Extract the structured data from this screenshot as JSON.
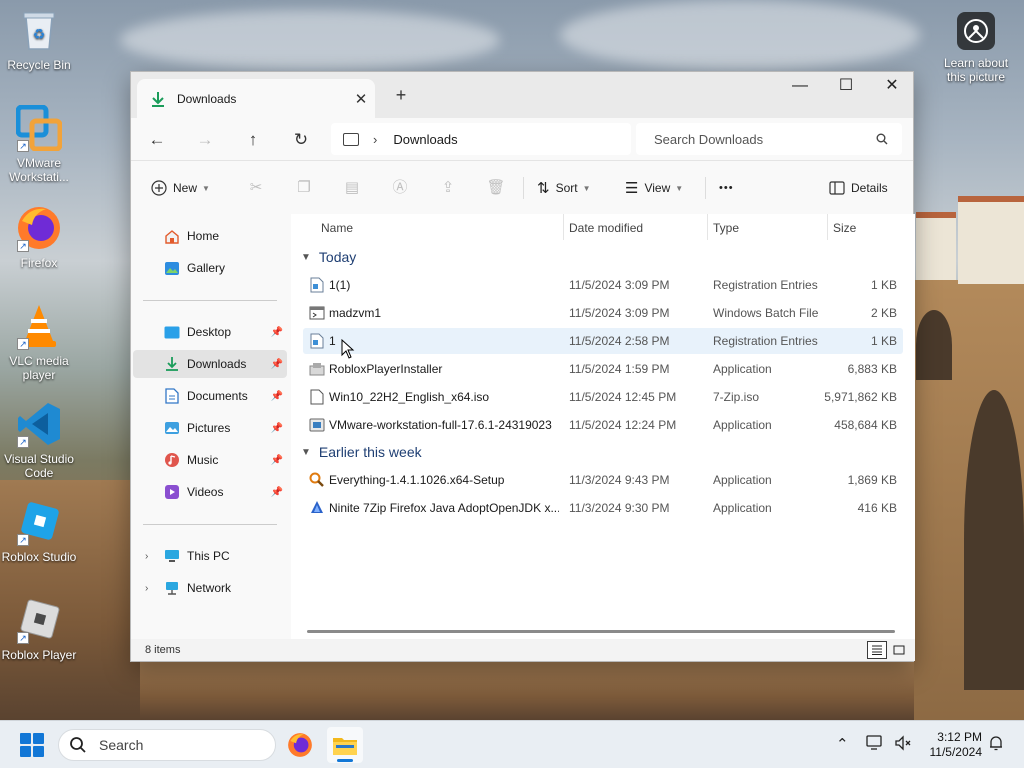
{
  "desktop": {
    "icons": [
      {
        "label": "Recycle Bin",
        "icon": "recycle-bin-icon"
      },
      {
        "label": "VMware Workstati...",
        "icon": "vmware-icon"
      },
      {
        "label": "Firefox",
        "icon": "firefox-icon"
      },
      {
        "label": "VLC media player",
        "icon": "vlc-icon"
      },
      {
        "label": "Visual Studio Code",
        "icon": "vscode-icon"
      },
      {
        "label": "Roblox Studio",
        "icon": "roblox-studio-icon"
      },
      {
        "label": "Roblox Player",
        "icon": "roblox-player-icon"
      }
    ],
    "learn_about": "Learn about this picture"
  },
  "window": {
    "tab_title": "Downloads",
    "new_tab": "+",
    "controls": {
      "minimize": "—",
      "maximize": "☐",
      "close": "✕"
    },
    "breadcrumb": "Downloads",
    "search_placeholder": "Search Downloads",
    "toolbar": {
      "new": "New",
      "sort": "Sort",
      "view": "View",
      "more": "•••",
      "details": "Details"
    }
  },
  "sidebar": {
    "items": [
      {
        "label": "Home",
        "icon": "home-icon"
      },
      {
        "label": "Gallery",
        "icon": "gallery-icon"
      },
      {
        "label": "Desktop",
        "icon": "desktop-folder-icon",
        "pinned": true
      },
      {
        "label": "Downloads",
        "icon": "downloads-icon",
        "pinned": true,
        "active": true
      },
      {
        "label": "Documents",
        "icon": "documents-icon",
        "pinned": true
      },
      {
        "label": "Pictures",
        "icon": "pictures-icon",
        "pinned": true
      },
      {
        "label": "Music",
        "icon": "music-icon",
        "pinned": true
      },
      {
        "label": "Videos",
        "icon": "videos-icon",
        "pinned": true
      },
      {
        "label": "This PC",
        "icon": "this-pc-icon"
      },
      {
        "label": "Network",
        "icon": "network-icon"
      }
    ]
  },
  "files": {
    "columns": [
      "Name",
      "Date modified",
      "Type",
      "Size"
    ],
    "groups": [
      {
        "label": "Today",
        "rows": [
          {
            "name": "1(1)",
            "date": "11/5/2024 3:09 PM",
            "type": "Registration Entries",
            "size": "1 KB",
            "icon": "registry-file-icon"
          },
          {
            "name": "madzvm1",
            "date": "11/5/2024 3:09 PM",
            "type": "Windows Batch File",
            "size": "2 KB",
            "icon": "batch-file-icon"
          },
          {
            "name": "1",
            "date": "11/5/2024 2:58 PM",
            "type": "Registration Entries",
            "size": "1 KB",
            "icon": "registry-file-icon",
            "selected": true
          },
          {
            "name": "RobloxPlayerInstaller",
            "date": "11/5/2024 1:59 PM",
            "type": "Application",
            "size": "6,883 KB",
            "icon": "roblox-installer-icon"
          },
          {
            "name": "Win10_22H2_English_x64.iso",
            "date": "11/5/2024 12:45 PM",
            "type": "7-Zip.iso",
            "size": "5,971,862 KB",
            "icon": "iso-file-icon"
          },
          {
            "name": "VMware-workstation-full-17.6.1-24319023",
            "date": "11/5/2024 12:24 PM",
            "type": "Application",
            "size": "458,684 KB",
            "icon": "vmware-installer-icon"
          }
        ]
      },
      {
        "label": "Earlier this week",
        "rows": [
          {
            "name": "Everything-1.4.1.1026.x64-Setup",
            "date": "11/3/2024 9:43 PM",
            "type": "Application",
            "size": "1,869 KB",
            "icon": "everything-icon"
          },
          {
            "name": "Ninite 7Zip Firefox Java AdoptOpenJDK x...",
            "date": "11/3/2024 9:30 PM",
            "type": "Application",
            "size": "416 KB",
            "icon": "ninite-icon"
          }
        ]
      }
    ]
  },
  "status": {
    "count": "8 items"
  },
  "taskbar": {
    "search": "Search",
    "time": "3:12 PM",
    "date": "11/5/2024"
  }
}
